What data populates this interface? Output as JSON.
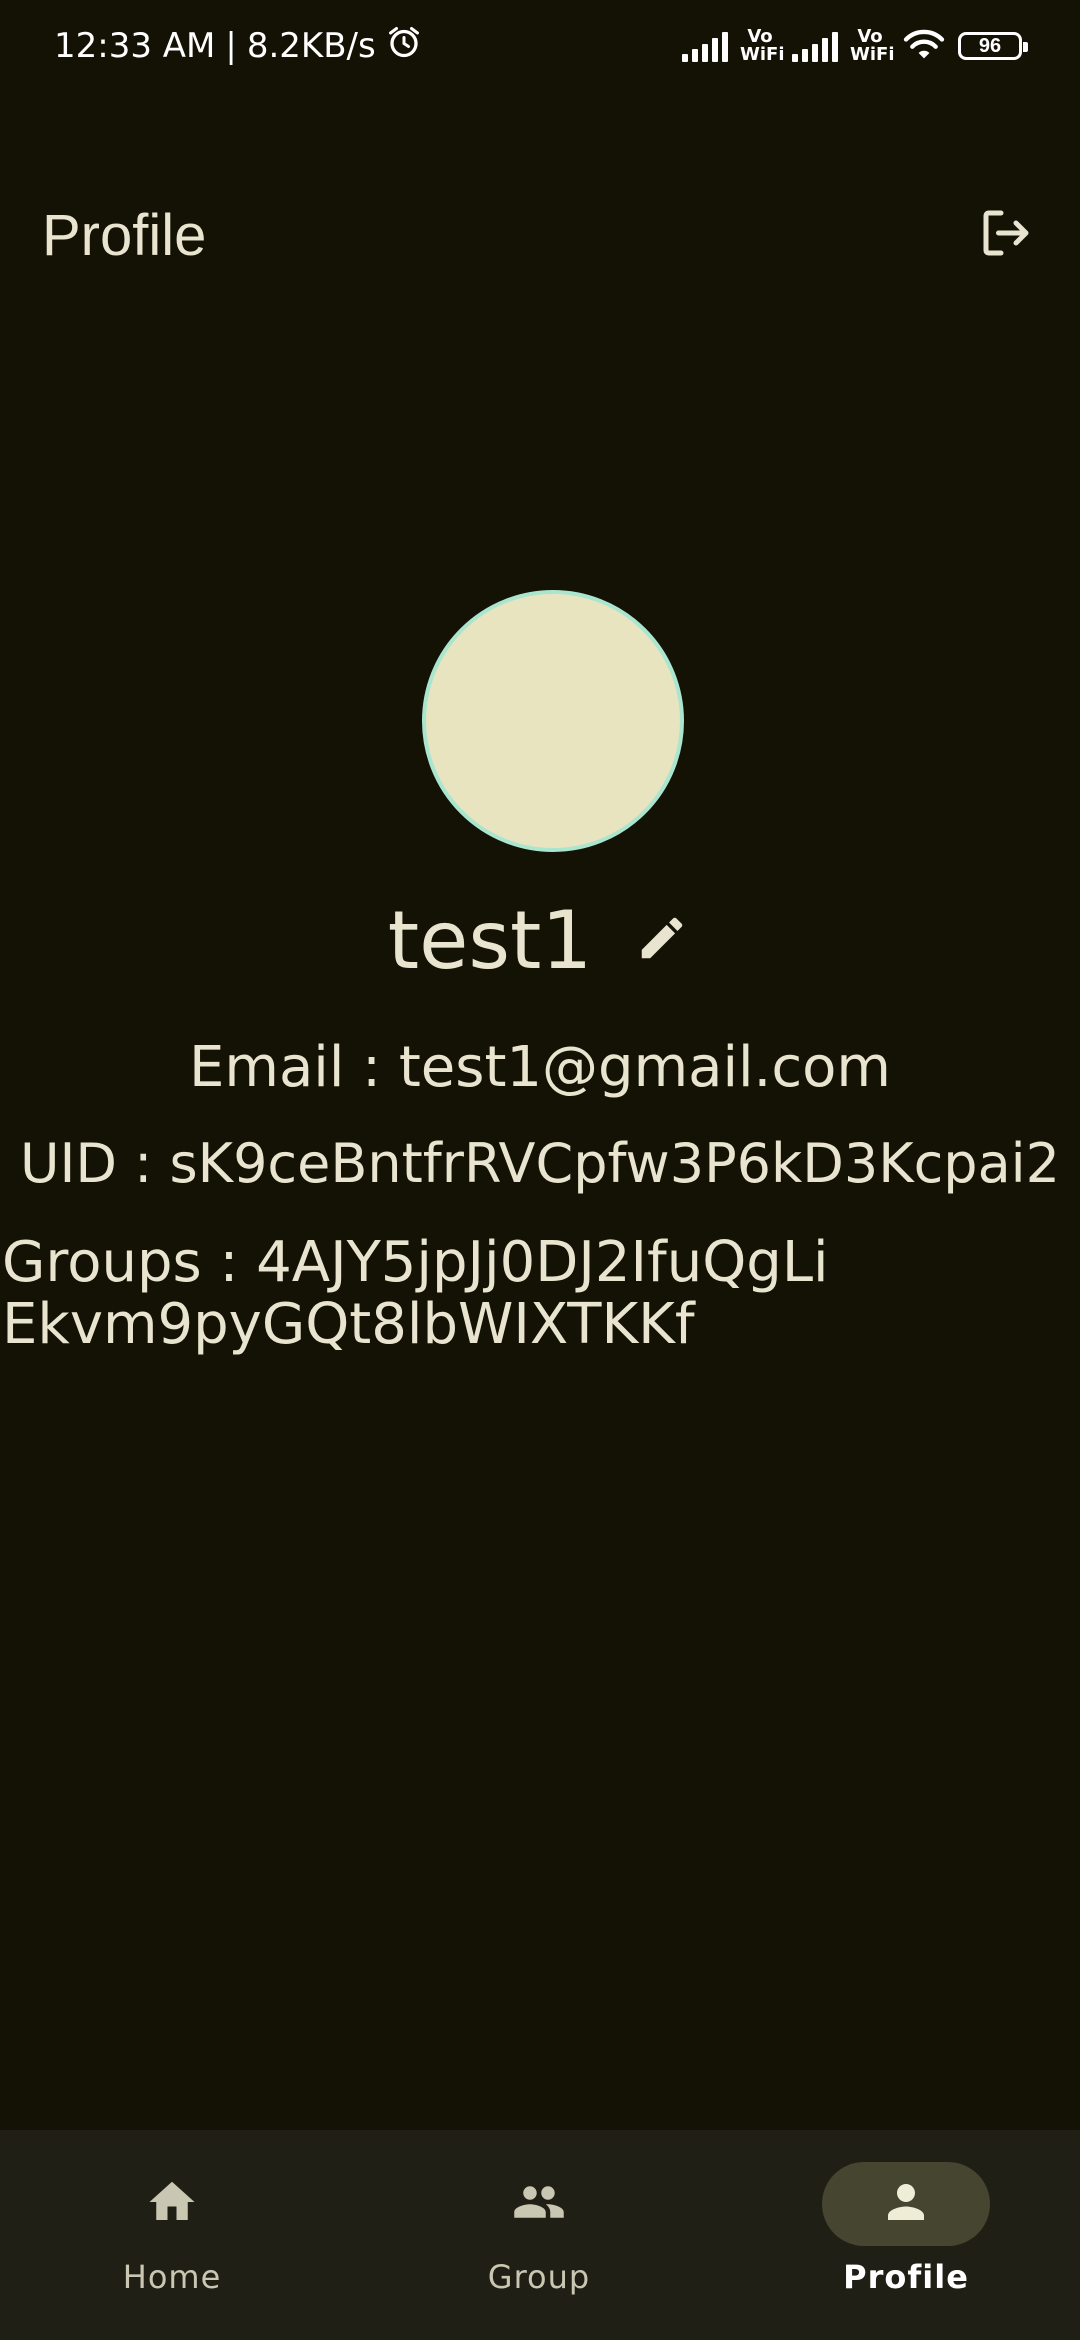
{
  "status_bar": {
    "time": "12:33 AM",
    "separator": "|",
    "net_speed": "8.2KB/s",
    "vowifi_top": "Vo",
    "vowifi_bottom": "WiFi",
    "battery": "96"
  },
  "header": {
    "title": "Profile",
    "logout_icon": "logout-icon"
  },
  "profile": {
    "name": "test1",
    "edit_icon": "pencil-icon",
    "email_line": "Email : test1@gmail.com",
    "uid_line": "UID : sK9ceBntfrRVCpfw3P6kD3Kcpai2",
    "groups_label": "Groups : ",
    "groups": [
      "4AJY5jpJj0DJ2IfuQgLi",
      "Ekvm9pyGQt8lbWIXTKKf"
    ]
  },
  "bottom_nav": {
    "items": [
      {
        "label": "Home",
        "icon": "home-icon",
        "active": false
      },
      {
        "label": "Group",
        "icon": "group-icon",
        "active": false
      },
      {
        "label": "Profile",
        "icon": "person-icon",
        "active": true
      }
    ]
  },
  "colors": {
    "background": "#141205",
    "text": "#e8e4cf",
    "avatar_fill": "#e8e4c0",
    "avatar_border": "#a9e5cf",
    "nav_background": "#201f16",
    "nav_active_pill": "#464530"
  }
}
